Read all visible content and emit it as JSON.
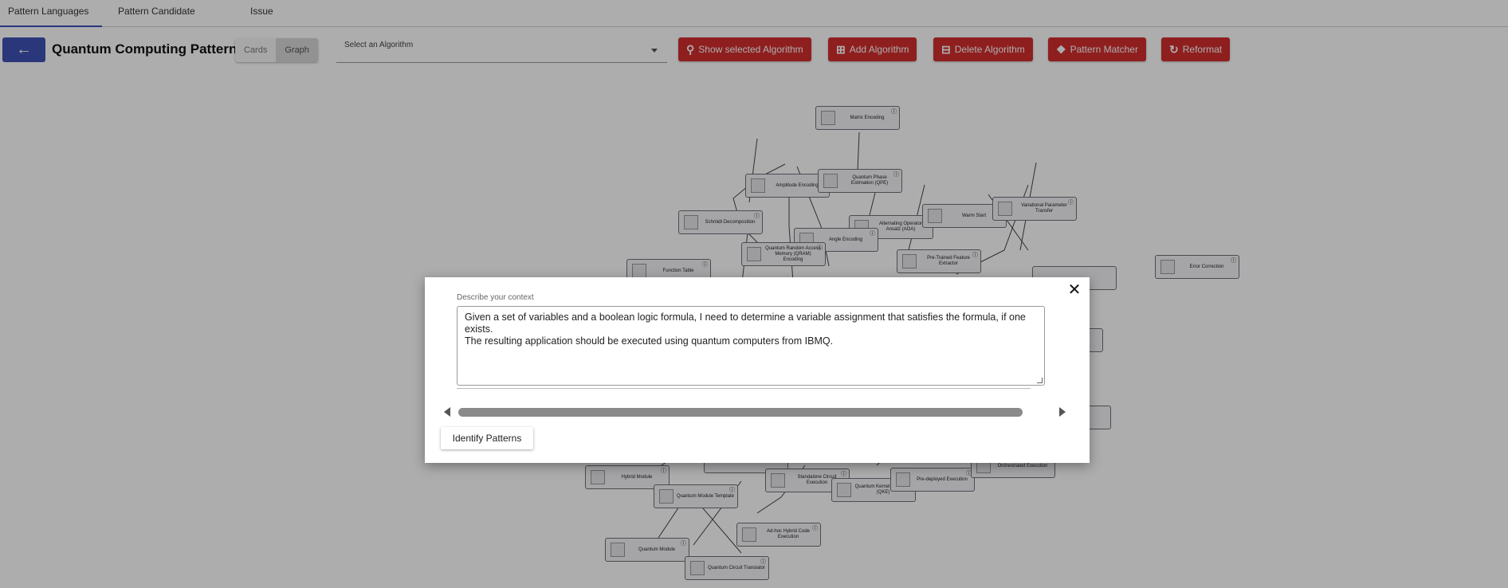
{
  "tabs": [
    {
      "label": "Pattern Languages",
      "active": true
    },
    {
      "label": "Pattern Candidate",
      "active": false
    },
    {
      "label": "Issue",
      "active": false
    }
  ],
  "toolbar": {
    "title": "Quantum Computing Patterns",
    "view_toggle": {
      "cards_label": "Cards",
      "graph_label": "Graph",
      "selected": "Graph"
    },
    "algorithm_select": {
      "label": "Select an Algorithm",
      "value": ""
    },
    "buttons": [
      {
        "label": "Show selected Algorithm",
        "icon": "search-icon"
      },
      {
        "label": "Add Algorithm",
        "icon": "plus-box-icon"
      },
      {
        "label": "Delete Algorithm",
        "icon": "minus-box-icon"
      },
      {
        "label": "Pattern Matcher",
        "icon": "puzzle-icon"
      },
      {
        "label": "Reformat",
        "icon": "refresh-icon"
      }
    ],
    "accent_color": "#3f51b5",
    "button_color": "#d32f2f"
  },
  "graph": {
    "nodes": [
      "Matrix Encoding",
      "Amplitude Encoding",
      "Quantum Phase Estimation (QPE)",
      "Schmidt Decomposition",
      "Alternating Operator Ansatz (AOA)",
      "Warm Start",
      "Variational Parameter Transfer",
      "Angle Encoding",
      "Quantum Random Access Memory (QRAM) Encoding",
      "Pre-Trained Feature Extractor",
      "Function Table",
      "Error Correction",
      "Hybrid Module",
      "Quantum Module Template",
      "Standalone Circuit Execution",
      "Quantum Kernel Estimator (QKE)",
      "Pre-deployed Execution",
      "Orchestrated Execution",
      "Ad-hoc Hybrid Code Execution",
      "Quantum Module",
      "Quantum Circuit Translator"
    ]
  },
  "modal": {
    "context_label": "Describe your context",
    "context_text": "Given a set of variables and a boolean logic formula, I need to determine a variable assignment that satisfies the formula, if one exists.\nThe resulting application should be executed using quantum computers from IBMQ.",
    "identify_button": "Identify Patterns"
  }
}
